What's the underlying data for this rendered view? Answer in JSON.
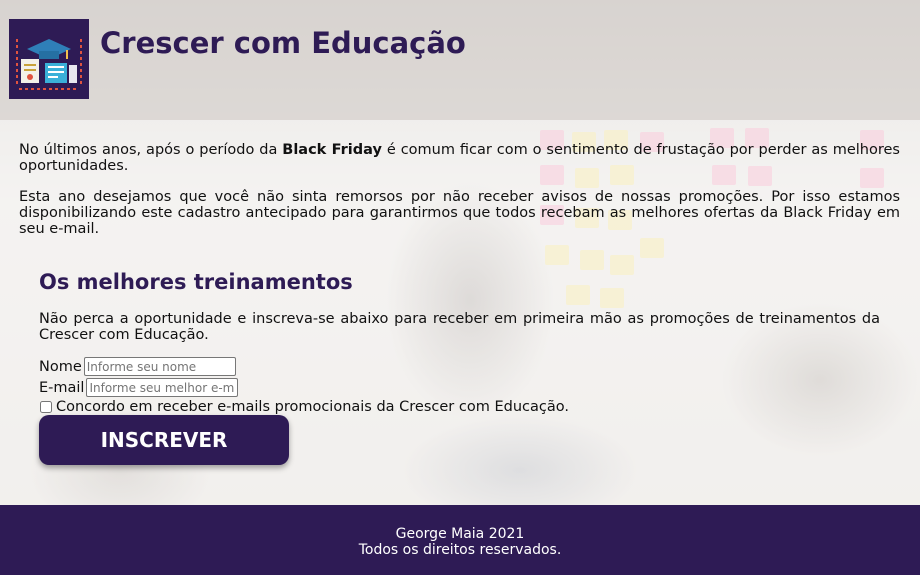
{
  "header": {
    "title": "Crescer com Educação",
    "logo_icon": "graduation-cap-certificate-icon"
  },
  "intro": {
    "p1_before": "No últimos anos, após o período da ",
    "p1_bold": "Black Friday",
    "p1_after": " é comum ficar com o sentimento de frustação por perder as melhores oportunidades.",
    "p2": "Esta ano desejamos que você não sinta remorsos por não receber avisos de nossas promoções. Por isso estamos disponibilizando este cadastro antecipado para garantirmos que todos recebam as melhores ofertas da Black Friday em seu e-mail."
  },
  "section": {
    "title": "Os melhores treinamentos",
    "text": "Não perca a oportunidade e inscreva-se abaixo para receber em primeira mão as promoções de treinamentos da Crescer com Educação."
  },
  "form": {
    "name_label": "Nome",
    "name_placeholder": "Informe seu nome",
    "name_value": "",
    "email_label": "E-mail",
    "email_placeholder": "Informe seu melhor e-mail",
    "email_value": "",
    "consent_label": "Concordo em receber e-mails promocionais da Crescer com Educação.",
    "consent_checked": false,
    "submit_label": "INSCREVER"
  },
  "footer": {
    "line1": "George Maia 2021",
    "line2": "Todos os direitos reservados."
  },
  "colors": {
    "brand": "#2e1b55",
    "button_text": "#ffffff"
  }
}
